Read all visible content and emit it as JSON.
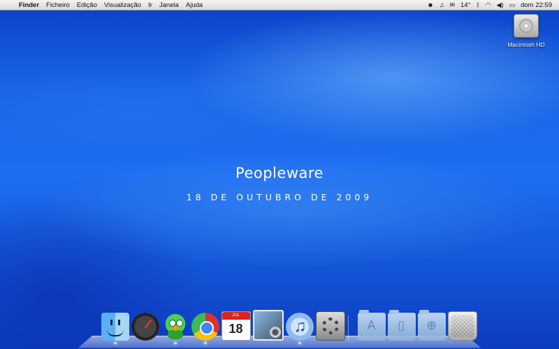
{
  "menubar": {
    "app_name": "Finder",
    "menus": [
      "Ficheiro",
      "Edição",
      "Visualização",
      "Ir",
      "Janela",
      "Ajuda"
    ],
    "status": {
      "temperature": "14°",
      "clock": "dom 22:59"
    }
  },
  "desktop": {
    "drive_label": "Macintosh HD",
    "title": "Peopleware",
    "subtitle": "18 DE OUTUBRO DE 2009"
  },
  "dock": {
    "calendar_day": "18",
    "calendar_month": "JUL"
  }
}
